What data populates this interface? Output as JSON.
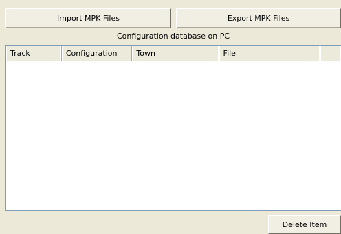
{
  "toolbar": {
    "import_label": "Import MPK Files",
    "export_label": "Export MPK Files"
  },
  "database": {
    "label": "Configuration database on PC"
  },
  "table": {
    "columns": [
      "Track",
      "Configuration",
      "Town",
      "File",
      ""
    ],
    "rows": []
  },
  "actions": {
    "delete_label": "Delete Item"
  }
}
